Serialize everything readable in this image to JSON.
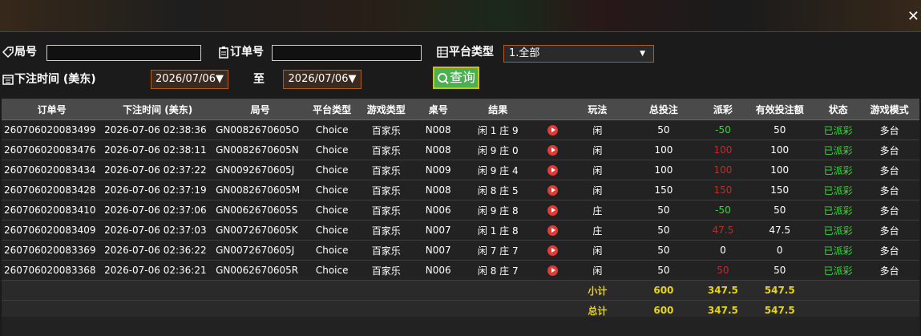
{
  "close_icon": "close-icon",
  "filters": {
    "round_label": "局号",
    "round_value": "",
    "order_label": "订单号",
    "order_value": "",
    "platform_label": "平台类型",
    "platform_value": "1.全部",
    "time_label": "下注时间 (美东)",
    "date_from": "2026/07/06▼",
    "to_label": "至",
    "date_to": "2026/07/06▼",
    "query_label": "查询"
  },
  "table": {
    "headers": [
      "订单号",
      "下注时间 (美东)",
      "局号",
      "平台类型",
      "游戏类型",
      "桌号",
      "结果",
      "",
      "玩法",
      "总投注",
      "派彩",
      "有效投注额",
      "状态",
      "游戏模式"
    ],
    "rows": [
      [
        "260706020083499",
        "2026-07-06 02:38:36",
        "GN0082670605O",
        "Choice",
        "百家乐",
        "N008",
        "闲 1 庄 9",
        "闲",
        "50",
        "-50",
        "50",
        "已派彩",
        "多台"
      ],
      [
        "260706020083476",
        "2026-07-06 02:38:11",
        "GN0082670605N",
        "Choice",
        "百家乐",
        "N008",
        "闲 9 庄 0",
        "闲",
        "100",
        "100",
        "100",
        "已派彩",
        "多台"
      ],
      [
        "260706020083434",
        "2026-07-06 02:37:22",
        "GN0092670605J",
        "Choice",
        "百家乐",
        "N009",
        "闲 9 庄 4",
        "闲",
        "100",
        "100",
        "100",
        "已派彩",
        "多台"
      ],
      [
        "260706020083428",
        "2026-07-06 02:37:19",
        "GN0082670605M",
        "Choice",
        "百家乐",
        "N008",
        "闲 8 庄 5",
        "闲",
        "150",
        "150",
        "150",
        "已派彩",
        "多台"
      ],
      [
        "260706020083410",
        "2026-07-06 02:37:06",
        "GN0062670605S",
        "Choice",
        "百家乐",
        "N006",
        "闲 9 庄 8",
        "庄",
        "50",
        "-50",
        "50",
        "已派彩",
        "多台"
      ],
      [
        "260706020083409",
        "2026-07-06 02:37:03",
        "GN0072670605K",
        "Choice",
        "百家乐",
        "N007",
        "闲 1 庄 8",
        "庄",
        "50",
        "47.5",
        "47.5",
        "已派彩",
        "多台"
      ],
      [
        "260706020083369",
        "2026-07-06 02:36:22",
        "GN0072670605J",
        "Choice",
        "百家乐",
        "N007",
        "闲 7 庄 7",
        "闲",
        "50",
        "0",
        "0",
        "已派彩",
        "多台"
      ],
      [
        "260706020083368",
        "2026-07-06 02:36:21",
        "GN0062670605R",
        "Choice",
        "百家乐",
        "N006",
        "闲 8 庄 7",
        "闲",
        "50",
        "50",
        "50",
        "已派彩",
        "多台"
      ]
    ],
    "payout_color": [
      "green",
      "red",
      "red",
      "red",
      "green",
      "red",
      "white",
      "red"
    ],
    "subtotal": {
      "label": "小计",
      "total_bet": "600",
      "payout": "347.5",
      "valid_bet": "547.5"
    },
    "total": {
      "label": "总计",
      "total_bet": "600",
      "payout": "347.5",
      "valid_bet": "547.5"
    }
  },
  "colors": {
    "accent": "#b25b1c",
    "query_button": "#4caf50",
    "status_green": "#3ad63a",
    "payout_red": "#c62828",
    "sum_yellow": "#e6d31c"
  }
}
